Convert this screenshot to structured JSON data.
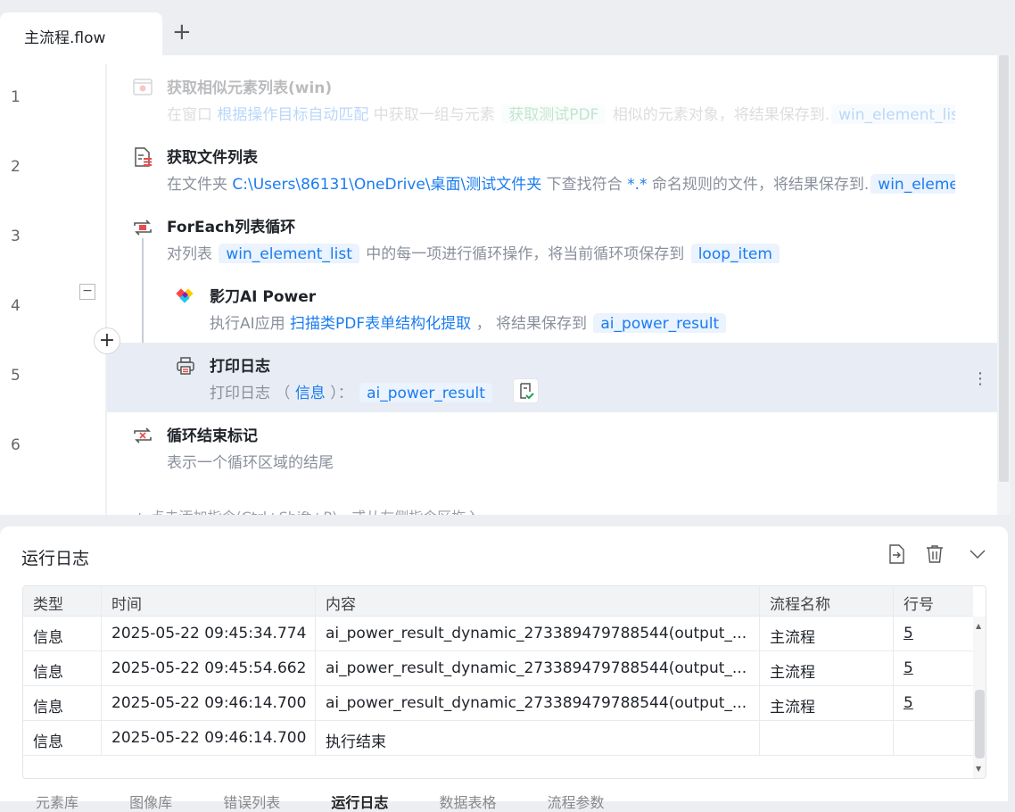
{
  "tabs": {
    "active": "主流程.flow",
    "add_icon": "plus-icon"
  },
  "lines": [
    "1",
    "2",
    "3",
    "4",
    "5",
    "6"
  ],
  "steps": [
    {
      "title": "获取相似元素列表(win)",
      "desc_pre": "在窗口 ",
      "link": "根据操作目标自动匹配",
      "desc_mid": " 中获取一组与元素 ",
      "var1": "获取测试PDF",
      "desc_mid2": " 相似的元素对象，将结果保存到.",
      "var2": "win_element_list",
      "icon": "window-element-icon"
    },
    {
      "title": "获取文件列表",
      "desc_pre": "在文件夹 ",
      "link": "C:\\Users\\86131\\OneDrive\\桌面\\测试文件夹",
      "desc_mid": " 下查找符合 ",
      "pattern": "*.*",
      "desc_mid2": " 命名规则的文件，将结果保存到.",
      "var2": "win_element_list",
      "icon": "file-list-icon"
    },
    {
      "title": "ForEach列表循环",
      "desc_pre": "对列表 ",
      "var1": "win_element_list",
      "desc_mid": " 中的每一项进行循环操作，将当前循环项保存到 ",
      "var2": "loop_item",
      "icon": "loop-icon"
    },
    {
      "title": "影刀AI Power",
      "desc_pre": "执行AI应用 ",
      "link": "扫描类PDF表单结构化提取",
      "desc_mid": " ， 将结果保存到 ",
      "var2": "ai_power_result",
      "icon": "ai-power-icon"
    },
    {
      "title": "打印日志",
      "desc_pre": "打印日志 （ ",
      "link": "信息",
      "desc_mid": " ）： ",
      "var2": "ai_power_result",
      "icon": "printer-icon"
    },
    {
      "title": "循环结束标记",
      "desc_pre": "表示一个循环区域的结尾",
      "icon": "loop-end-icon"
    }
  ],
  "hint": "+ 点击添加指令(Ctrl+Shift+P)，或从左侧指令区拖入",
  "log": {
    "title": "运行日志",
    "columns": [
      "类型",
      "时间",
      "内容",
      "流程名称",
      "行号"
    ],
    "rows": [
      [
        "信息",
        "2025-05-22 09:45:34.774",
        "ai_power_result_dynamic_273389479788544(output_...",
        "主流程",
        "5"
      ],
      [
        "信息",
        "2025-05-22 09:45:54.662",
        "ai_power_result_dynamic_273389479788544(output_...",
        "主流程",
        "5"
      ],
      [
        "信息",
        "2025-05-22 09:46:14.700",
        "ai_power_result_dynamic_273389479788544(output_...",
        "主流程",
        "5"
      ],
      [
        "信息",
        "2025-05-22 09:46:14.700",
        "执行结束",
        "",
        ""
      ]
    ]
  },
  "bottom_tabs": [
    "元素库",
    "图像库",
    "错误列表",
    "运行日志",
    "数据表格",
    "流程参数"
  ],
  "colors": {
    "accent": "#1a7cf0",
    "highlight_row": "#e8edf5"
  }
}
